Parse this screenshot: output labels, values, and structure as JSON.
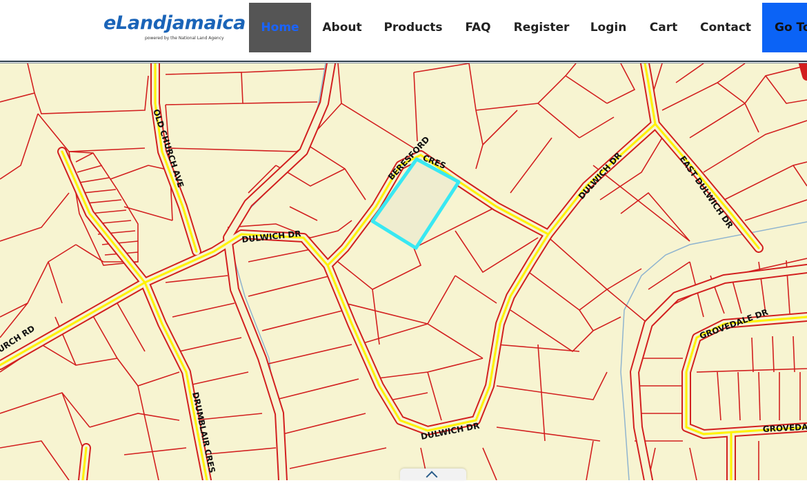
{
  "header": {
    "logo": {
      "brand": "eLandjamaica",
      "tagline": "powered by the National Land Agency"
    },
    "nav": [
      {
        "id": "home",
        "label": "Home"
      },
      {
        "id": "about",
        "label": "About"
      },
      {
        "id": "products",
        "label": "Products"
      },
      {
        "id": "faq",
        "label": "FAQ"
      },
      {
        "id": "register",
        "label": "Register"
      },
      {
        "id": "login",
        "label": "Login"
      },
      {
        "id": "cart",
        "label": "Cart"
      },
      {
        "id": "contact",
        "label": "Contact"
      },
      {
        "id": "goto",
        "label": "Go To"
      }
    ]
  },
  "map": {
    "colors": {
      "background": "#f7f4d1",
      "parcel_line": "#d21f1f",
      "road_fill": "#fff200",
      "highlight": "#39e8f2",
      "water": "#8fb4cf"
    },
    "road_labels": {
      "old_church_ave": "OLD CHURCH AVE",
      "beresford_cres": "BERESFORD CRES",
      "dulwich_dr_north": "DULWICH DR",
      "east_dulwich_dr": "EAST DULWICH DR",
      "dulwich_dr_west": "DULWICH DR",
      "church_rd": "URCH RD",
      "grovedale_dr": "GROVEDALE DR",
      "dulwich_dr_south": "DULWICH DR",
      "drumblair_cres": "DRUMBLAIR CRES",
      "groveda": "GROVEDA"
    }
  },
  "scroll_top": {
    "icon": "chevron-up-icon"
  }
}
